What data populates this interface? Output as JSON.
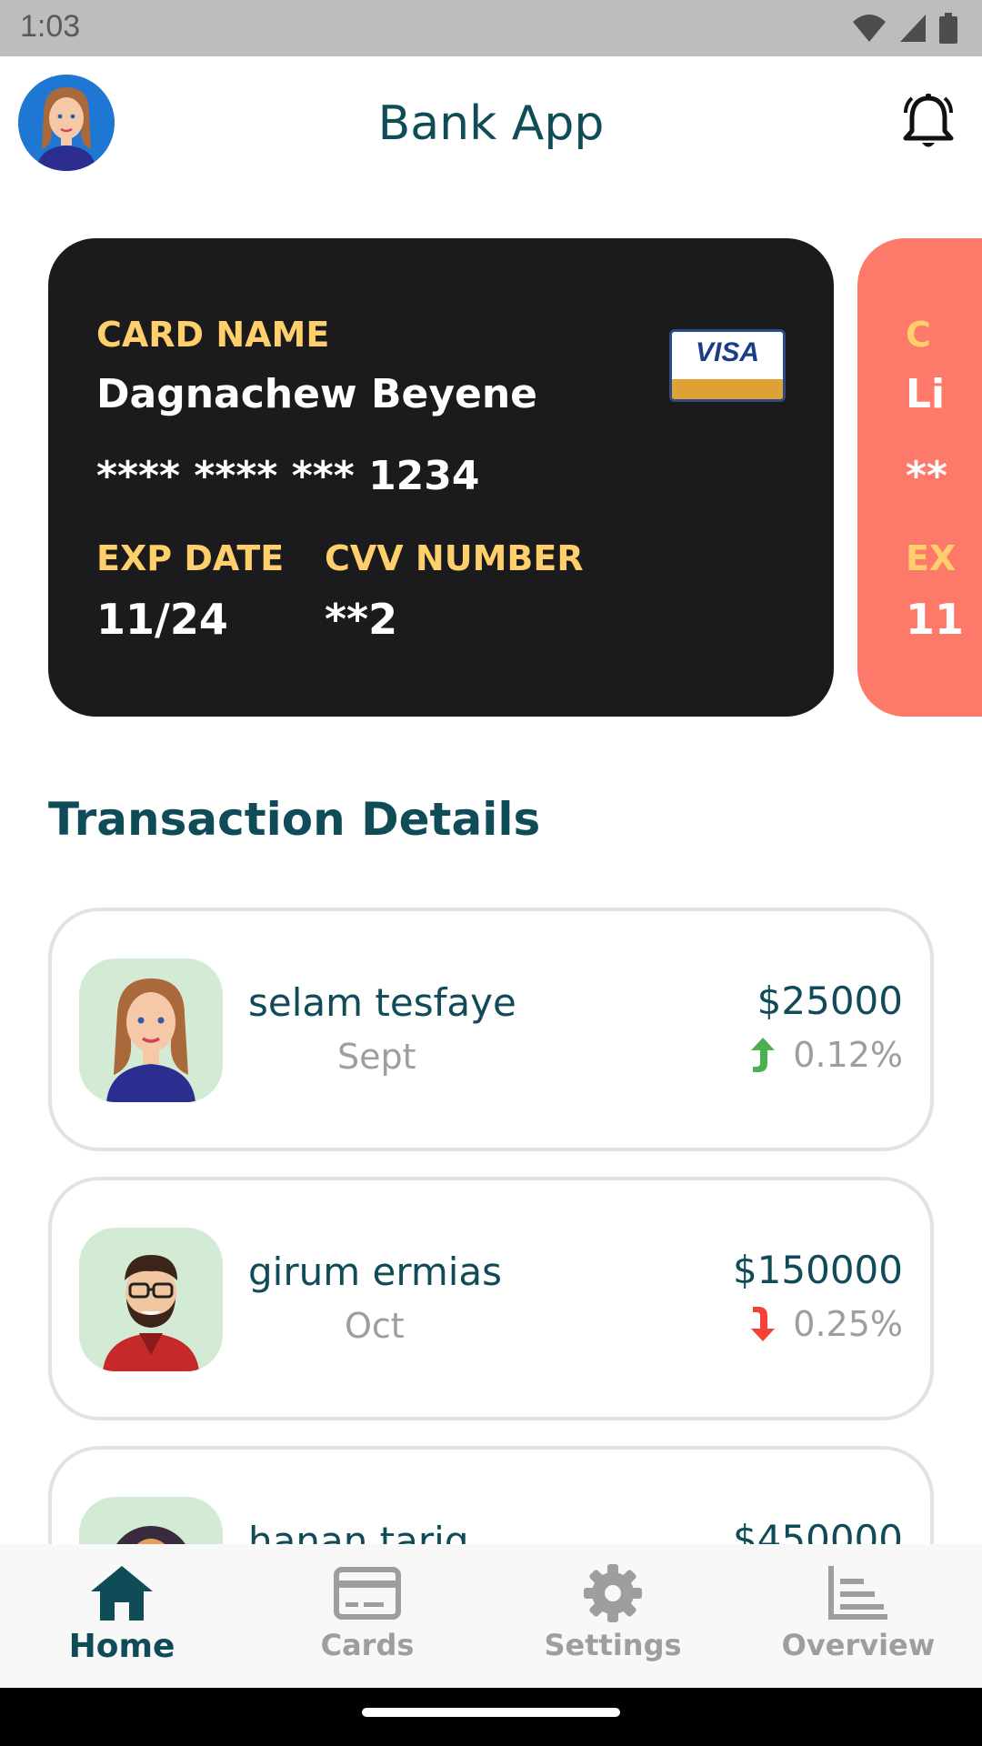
{
  "status_bar": {
    "time": "1:03"
  },
  "header": {
    "title": "Bank App"
  },
  "cards": {
    "primary": {
      "name_label": "CARD NAME",
      "holder": "Dagnachew Beyene",
      "number": "**** **** *** 1234",
      "exp_label": "EXP DATE",
      "exp_value": "11/24",
      "cvv_label": "CVV NUMBER",
      "cvv_value": "**2",
      "brand": "VISA"
    },
    "secondary": {
      "name_label_partial": "C",
      "holder_partial": "Li",
      "number_partial": "**",
      "exp_label_partial": "EX",
      "exp_value_partial": "11"
    }
  },
  "section": {
    "title": "Transaction Details"
  },
  "transactions": [
    {
      "name": "selam tesfaye",
      "month": "Sept",
      "amount": "$25000",
      "change": "0.12%",
      "direction": "up"
    },
    {
      "name": "girum ermias",
      "month": "Oct",
      "amount": "$150000",
      "change": "0.25%",
      "direction": "down"
    },
    {
      "name": "hanan tariq",
      "amount": "$450000"
    }
  ],
  "bottom_nav": {
    "home": "Home",
    "cards": "Cards",
    "settings": "Settings",
    "overview": "Overview"
  },
  "colors": {
    "primary": "#0f4c57",
    "card_dark": "#1b1b1d",
    "card_coral": "#fd7a6a",
    "card_label": "#ffcf6b",
    "up": "#4caf50",
    "down": "#f44336",
    "avatar_bg": "#d3ebd4"
  }
}
